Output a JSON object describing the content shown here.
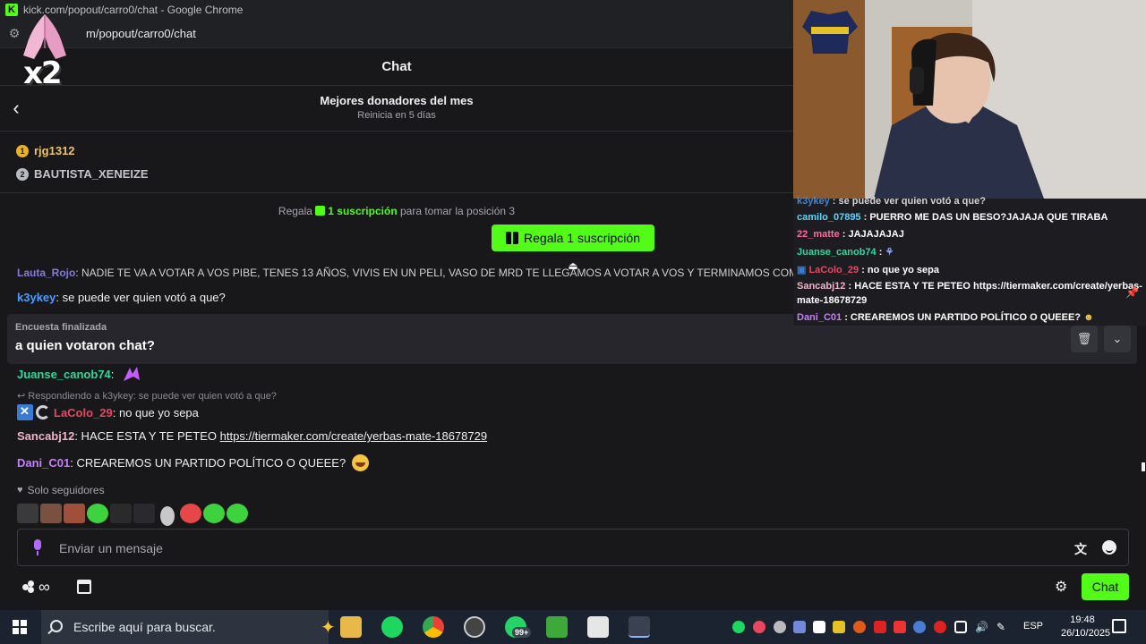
{
  "browser": {
    "title": "kick.com/popout/carro0/chat - Google Chrome",
    "url": "m/popout/carro0/chat"
  },
  "overlay_emote": {
    "multiplier": "x2"
  },
  "chat": {
    "header_title": "Chat",
    "donors_title": "Mejores donadores del mes",
    "donors_sub": "Reinicia en 5 días",
    "leaders": [
      {
        "rank": "1",
        "name": "rjg1312"
      },
      {
        "rank": "2",
        "name": "BAUTISTA_XENEIZE"
      }
    ],
    "gift_prefix": "Regala",
    "gift_highlight": "1 suscripción",
    "gift_suffix": "para tomar la posición 3",
    "gift_button": "Regala 1 suscripción",
    "messages": {
      "lauta": {
        "user": "Lauta_Rojo",
        "text": ": NADIE TE VA A VOTAR A VOS PIBE, TENES 13 AÑOS, VIVIS EN UN PELI, VASO DE MRD TE LLEGAMOS A VOTAR A VOS Y TERMINAMOS COMIENDO TIERRA ABAJO DE LA LLUVIA FORRO"
      },
      "k3ykey": {
        "user": "k3ykey",
        "text": ": se puede ver quien votó a que?"
      },
      "juanse": {
        "user": "Juanse_canob74",
        "text": ":"
      },
      "reply": "Respondiendo a k3ykey: se puede ver quien votó a que?",
      "lacolo": {
        "user": "LaColo_29",
        "text": ": no que yo sepa"
      },
      "sanca": {
        "user": "Sancabj12",
        "text": ": HACE ESTA Y TE PETEO ",
        "link": "https://tiermaker.com/create/yerbas-mate-18678729"
      },
      "dani": {
        "user": "Dani_C01",
        "text": ": CREAREMOS UN PARTIDO POLÍTICO O QUEEE?"
      }
    },
    "poll": {
      "label": "Encuesta finalizada",
      "question": "a quien votaron chat?"
    },
    "followers_only": "Solo seguidores",
    "input_placeholder": "Enviar un mensaje",
    "chat_button": "Chat"
  },
  "overlay_chat": [
    {
      "user": "k3ykey",
      "text": " : se puede ver quien votó a que?"
    },
    {
      "user": "camilo_07895",
      "text": " : PUERRO ME DAS UN BESO?JAJAJA QUE TIRABA"
    },
    {
      "user": "22_matte",
      "text": " : JAJAJAJAJ"
    },
    {
      "user": "Juanse_canob74",
      "text": " :"
    },
    {
      "user": "LaColo_29",
      "text": " : no que yo sepa"
    },
    {
      "user": "Sancabj12",
      "text": " : HACE ESTA Y TE PETEO https://tiermaker.com/create/yerbas-"
    },
    {
      "user": "",
      "text": "mate-18678729"
    },
    {
      "user": "Dani_C01",
      "text": " : CREAREMOS UN PARTIDO POLÍTICO O QUEEE?"
    }
  ],
  "taskbar": {
    "search_placeholder": "Escribe aquí para buscar.",
    "badge": "99+",
    "lang": "ESP",
    "time": "19:48",
    "date": "26/10/2025"
  },
  "colors": {
    "kick_green": "#53fc18",
    "bg": "#18181b"
  }
}
